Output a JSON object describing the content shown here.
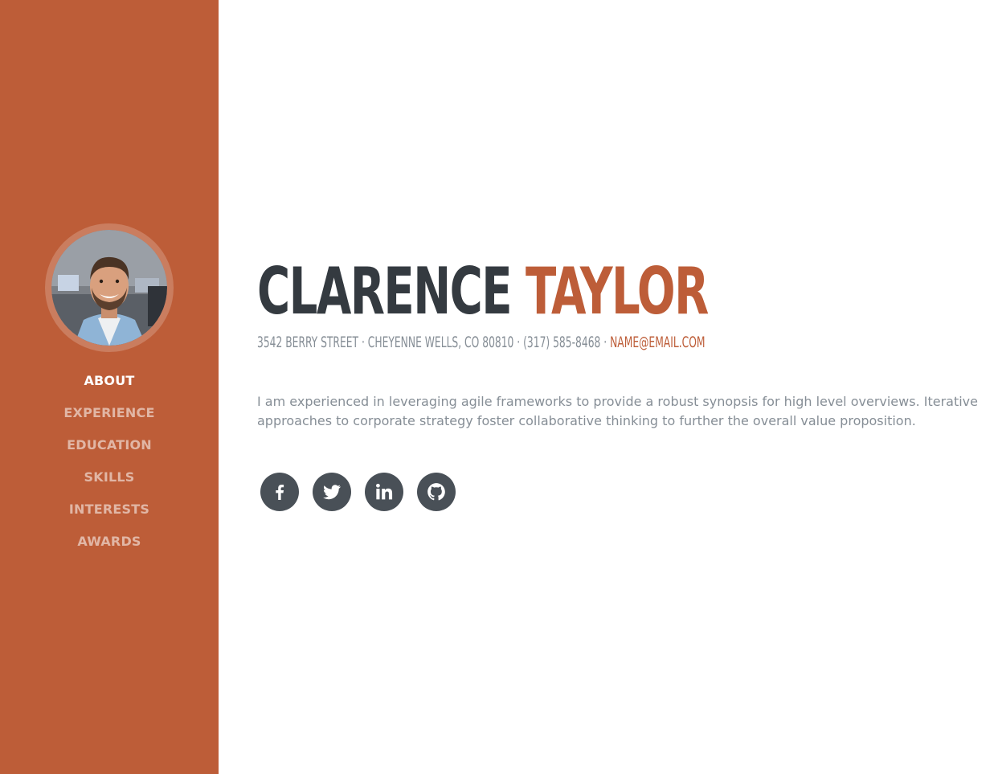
{
  "sidebar": {
    "accent_color": "#bd5d38",
    "avatar_alt": "profile-photo",
    "nav": [
      {
        "label": "About",
        "active": true
      },
      {
        "label": "Experience",
        "active": false
      },
      {
        "label": "Education",
        "active": false
      },
      {
        "label": "Skills",
        "active": false
      },
      {
        "label": "Interests",
        "active": false
      },
      {
        "label": "Awards",
        "active": false
      }
    ]
  },
  "about": {
    "first_name": "CLARENCE",
    "last_name": "TAYLOR",
    "address": "3542 Berry Street · Cheyenne Wells, CO 80810 · (317) 585-8468 ·",
    "email": "name@email.com",
    "intro": "I am experienced in leveraging agile frameworks to provide a robust synopsis for high level overviews. Iterative approaches to corporate strategy foster collaborative thinking to further the overall value proposition."
  },
  "social": [
    {
      "name": "facebook",
      "icon": "facebook-icon"
    },
    {
      "name": "twitter",
      "icon": "twitter-icon"
    },
    {
      "name": "linkedin",
      "icon": "linkedin-icon"
    },
    {
      "name": "github",
      "icon": "github-icon"
    }
  ]
}
